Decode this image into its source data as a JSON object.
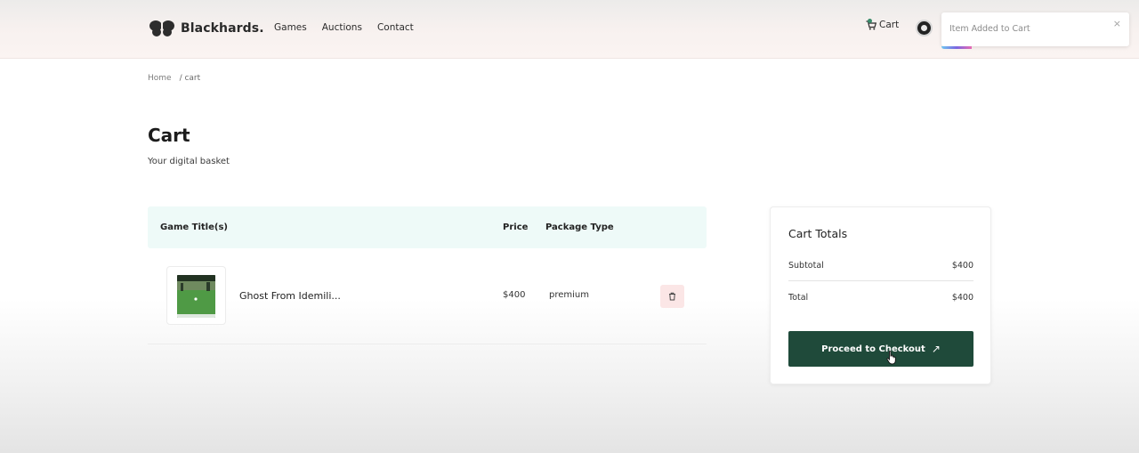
{
  "brand": {
    "name": "Blackhards."
  },
  "nav": {
    "items": [
      "Games",
      "Auctions",
      "Contact"
    ]
  },
  "header": {
    "cart_label": "Cart"
  },
  "toast": {
    "message": "Item Added to Cart",
    "close": "×"
  },
  "breadcrumb": {
    "home": "Home",
    "current": "/ cart"
  },
  "page": {
    "title": "Cart",
    "subtitle": "Your digital basket"
  },
  "table": {
    "headers": {
      "title": "Game Title(s)",
      "price": "Price",
      "package": "Package Type"
    },
    "rows": [
      {
        "title": "Ghost From Idemili...",
        "price": "$400",
        "package": "premium"
      }
    ]
  },
  "totals": {
    "title": "Cart Totals",
    "subtotal_label": "Subtotal",
    "subtotal_value": "$400",
    "total_label": "Total",
    "total_value": "$400",
    "checkout_label": "Proceed to Checkout",
    "checkout_icon": "↗"
  },
  "colors": {
    "accent": "#1f4a3a",
    "table_header_bg": "#eefaf8",
    "delete_bg": "#fbe6e6"
  }
}
